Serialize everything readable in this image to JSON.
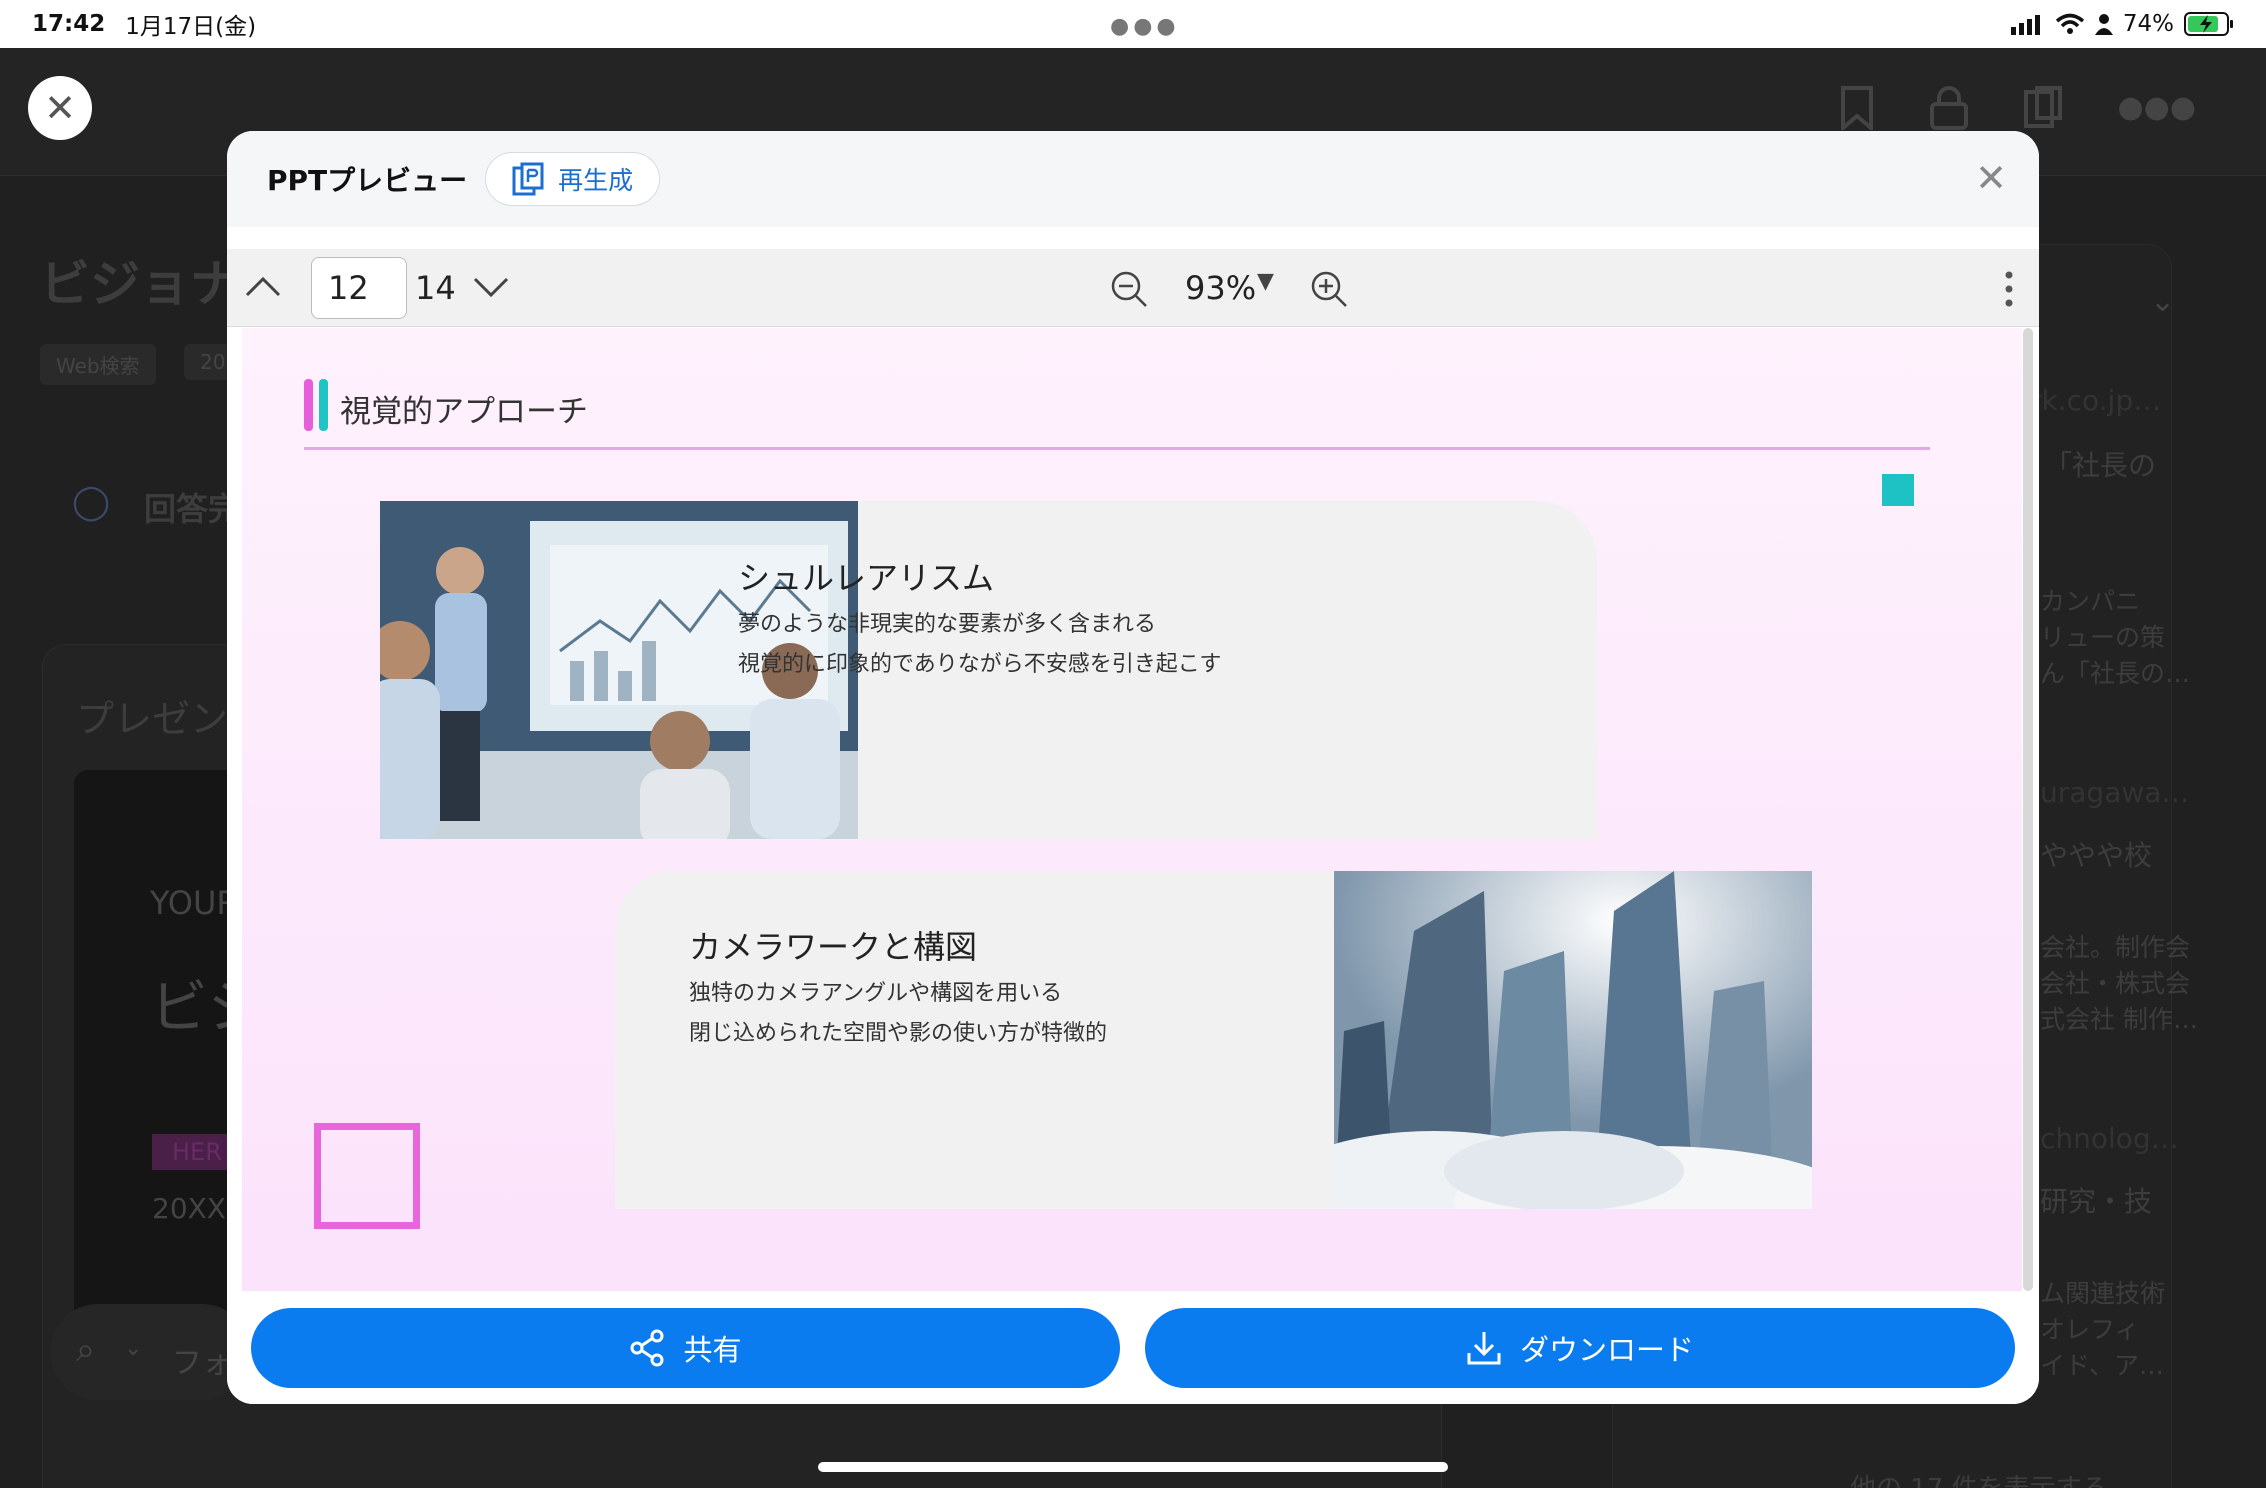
{
  "status_bar": {
    "time": "17:42",
    "date": "1月17日(金)",
    "battery": "74%"
  },
  "background": {
    "title_fragment": "ビジョナ",
    "tag_1": "Web検索",
    "tag_2": "20",
    "answer_fragment": "回答完",
    "present_fragment": "プレゼン",
    "card_text_1": "YOUR",
    "card_text_2": "ビジ",
    "card_text_3": "HER",
    "card_text_4": "20XX.",
    "search_placeholder": "フォ",
    "right_snippets": [
      "rk.co.jp…",
      "、「社長の",
      "カンパニ",
      "リューの策",
      "ん「社長の…",
      "uragawa…",
      "ややや校",
      "会社。制作会",
      "会社・株式会",
      "式会社 制作…",
      "chnolog…",
      "研究・技",
      "ム関連技術",
      "オレフィ",
      "イド、ア…",
      "他の 17 件を表示する"
    ]
  },
  "modal": {
    "title": "PPTプレビュー",
    "regenerate_label": "再生成",
    "toolbar": {
      "current_page": "12",
      "total_pages": "14",
      "zoom": "93%"
    },
    "slide": {
      "title": "視覚的アプローチ",
      "items": [
        {
          "heading": "シュルレアリスム",
          "line1": "夢のような非現実的な要素が多く含まれる",
          "line2": "視覚的に印象的でありながら不安感を引き起こす"
        },
        {
          "heading": "カメラワークと構図",
          "line1": "独特のカメラアングルや構図を用いる",
          "line2": "閉じ込められた空間や影の使い方が特徴的"
        }
      ]
    },
    "share_label": "共有",
    "download_label": "ダウンロード"
  },
  "colors": {
    "accent_blue": "#0a7cf0",
    "slide_pink": "#e865dc",
    "slide_teal": "#1fc2c4"
  }
}
